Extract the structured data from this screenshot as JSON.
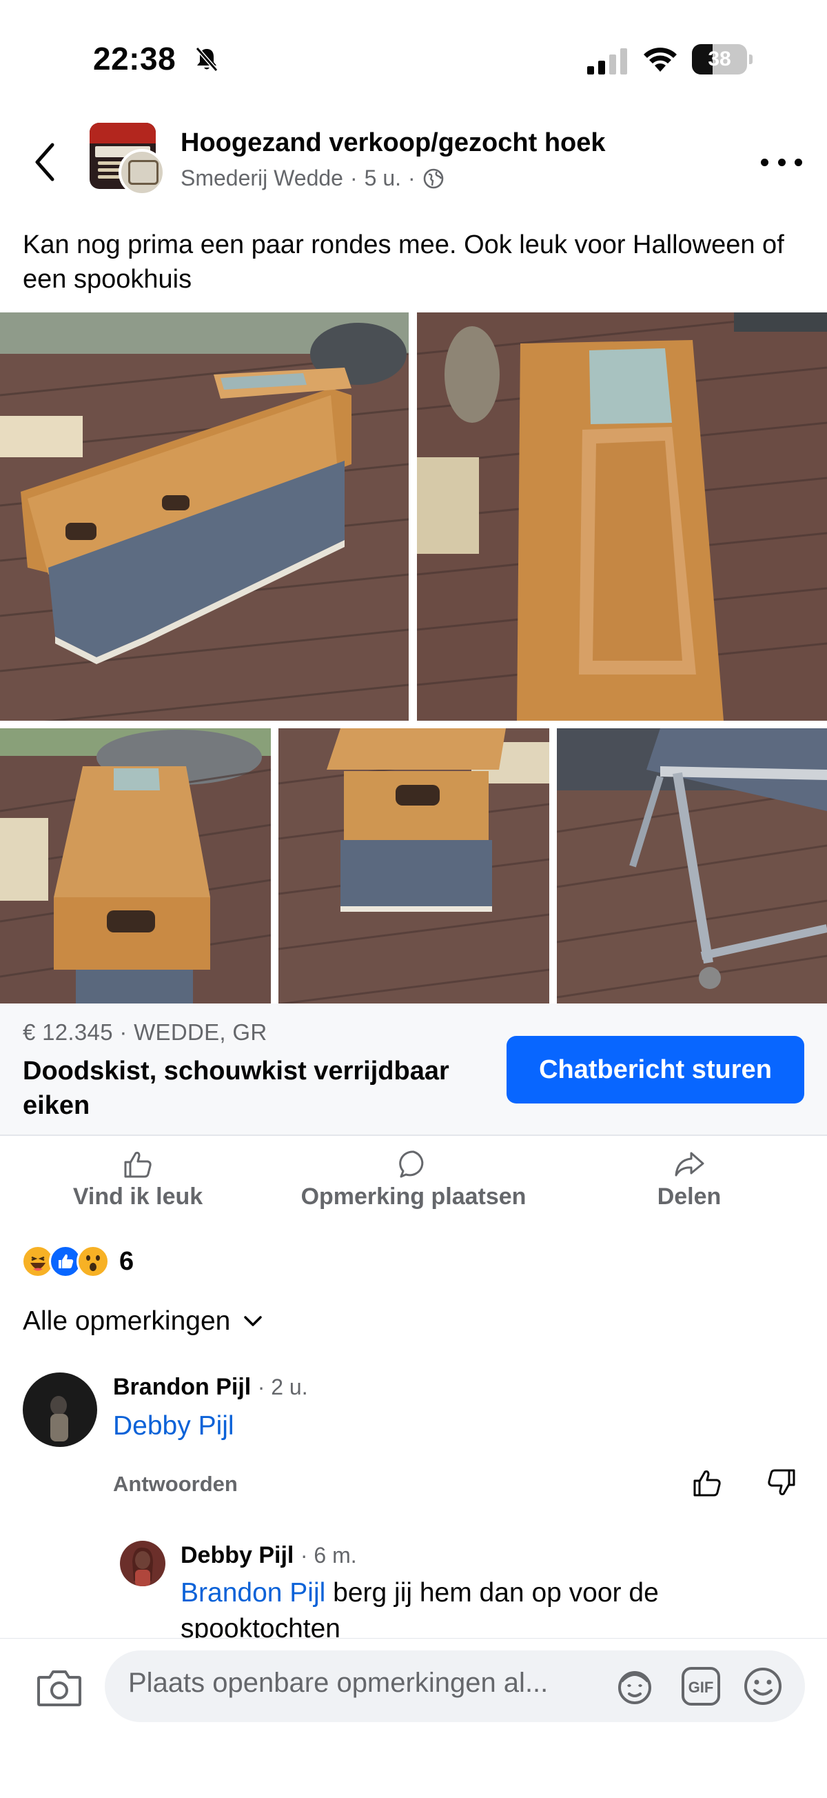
{
  "status_bar": {
    "time": "22:38",
    "battery": "38",
    "battery_level": 0.38
  },
  "post": {
    "group_name": "Hoogezand verkoop/gezocht hoek",
    "author": "Smederij Wedde",
    "time_ago": "5 u.",
    "text": "Kan nog prima een paar rondes mee. Ook leuk voor Halloween of een spookhuis",
    "icons": {
      "back": "chevron-left-icon",
      "more": "more-dots-icon",
      "audience": "globe-icon"
    }
  },
  "listing": {
    "price_location": "€ 12.345 · WEDDE, GR",
    "title": "Doodskist, schouwkist verrijdbaar eiken",
    "chat_button": "Chatbericht sturen",
    "accent_color": "#0866ff"
  },
  "actions": {
    "like": "Vind ik leuk",
    "comment": "Opmerking plaatsen",
    "share": "Delen"
  },
  "reactions": {
    "types": [
      "haha",
      "like",
      "wow"
    ],
    "count": "6"
  },
  "comments_filter": "Alle opmerkingen",
  "comments": [
    {
      "author": "Brandon Pijl",
      "time": "· 2 u.",
      "mention": "Debby Pijl",
      "text": "",
      "reply_label": "Antwoorden"
    },
    {
      "author": "Debby Pijl",
      "time": "· 6 m.",
      "mention": "Brandon Pijl",
      "text": " berg jij hem dan op voor de spooktochten"
    }
  ],
  "composer": {
    "placeholder": "Plaats openbare opmerkingen al...",
    "tools": [
      "camera-icon",
      "avatar-sticker-icon",
      "gif-icon",
      "emoji-icon"
    ]
  }
}
